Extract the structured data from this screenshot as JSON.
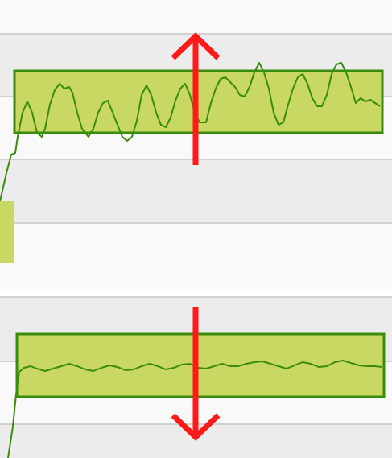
{
  "colors": {
    "band_light": "#f9f9f9",
    "band_mid": "#ececec",
    "separator": "#ffffff",
    "gridline": "#c6c6c6",
    "box_fill": "#c8d862",
    "box_stroke": "#3a8c0e",
    "line": "#3a8c0e",
    "arrow": "#ff1a1a"
  },
  "panels": [
    {
      "name": "top-panel",
      "arrow": "up-arrow-icon",
      "amplitude": "large"
    },
    {
      "name": "bottom-panel",
      "arrow": "down-arrow-icon",
      "amplitude": "small"
    }
  ]
}
